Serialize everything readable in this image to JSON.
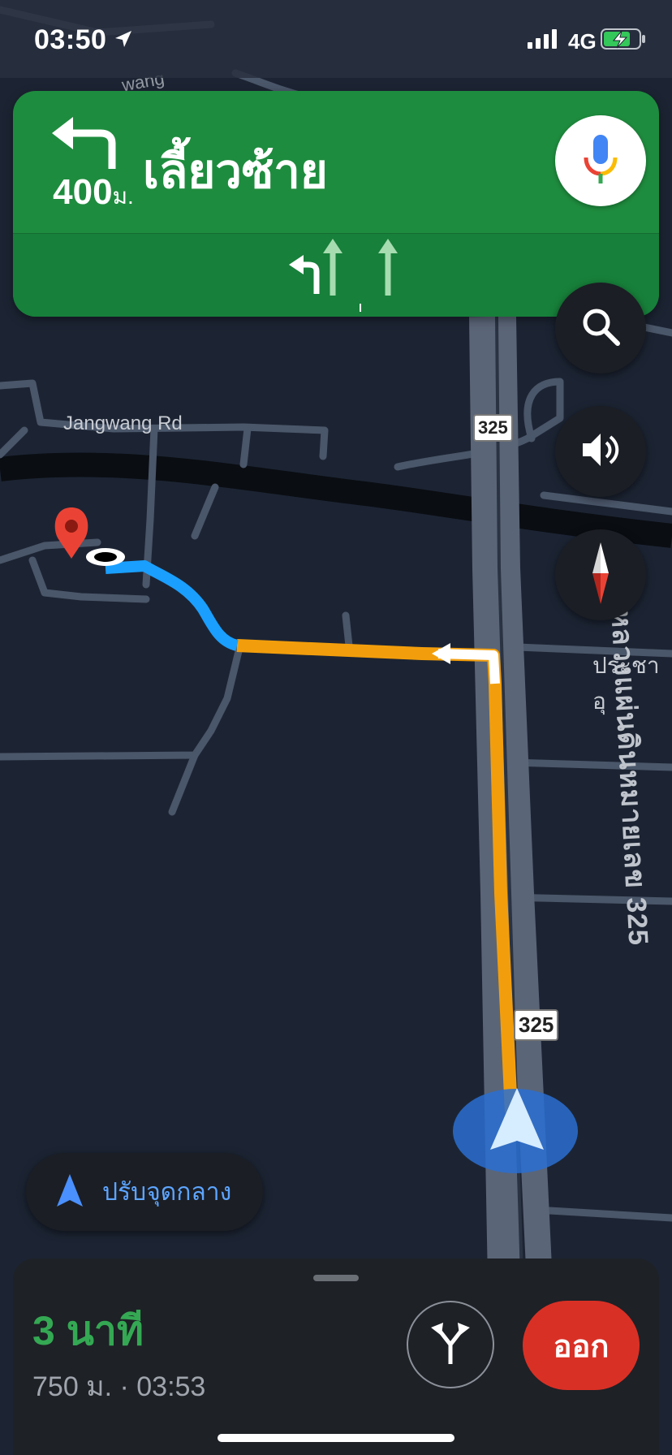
{
  "status_bar": {
    "time": "03:50",
    "network": "4G",
    "icons": [
      "location-arrow-icon",
      "signal-bars-icon",
      "battery-charging-icon"
    ]
  },
  "navigation": {
    "distance_value": "400",
    "distance_unit": "ม.",
    "instruction": "เลี้ยวซ้าย",
    "maneuver_icon": "turn-left-icon",
    "lanes": [
      "left-turn",
      "straight",
      "straight"
    ],
    "banner_color": "#1e8c3e"
  },
  "map": {
    "street_label": "Jangwang Rd",
    "street_label_top": "wang",
    "highway_name": "ทางหลวงแผ่นดินหมายเลข 325",
    "side_label": "ประชาอุ",
    "shields": [
      "325",
      "325"
    ],
    "route_colors": {
      "traffic_slow": "#f29e0c",
      "clear": "#1a9fff"
    }
  },
  "controls": {
    "search_icon": "search-icon",
    "sound_icon": "speaker-icon",
    "compass_icon": "compass-icon",
    "mic_icon": "microphone-icon",
    "recenter_label": "ปรับจุดกลาง"
  },
  "trip": {
    "eta_duration": "3 นาที",
    "details": "750 ม. · 03:53",
    "exit_label": "ออก",
    "exit_color": "#d93025"
  }
}
